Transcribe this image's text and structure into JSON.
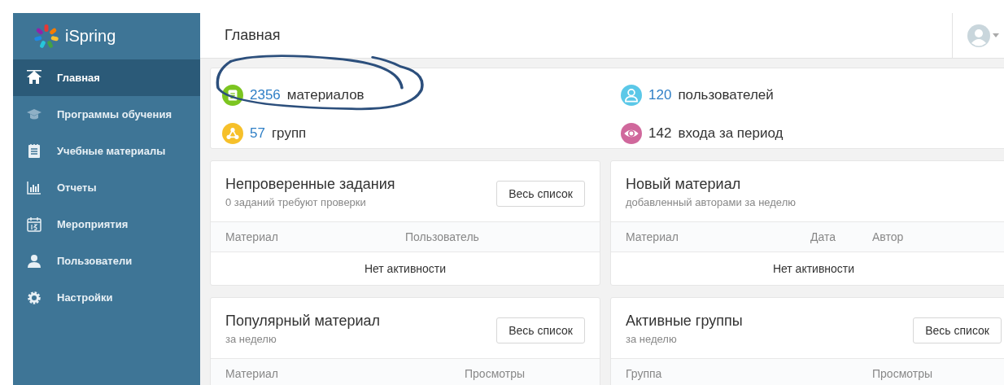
{
  "sidebar": {
    "logo": "iSpring",
    "items": [
      {
        "label": "Главная",
        "kind": "home",
        "selected": true
      },
      {
        "label": "Программы обучения",
        "kind": "cap",
        "selected": false
      },
      {
        "label": "Учебные материалы",
        "kind": "notepad",
        "selected": false
      },
      {
        "label": "Отчеты",
        "kind": "chart",
        "selected": false
      },
      {
        "label": "Мероприятия",
        "kind": "calendar",
        "selected": false
      },
      {
        "label": "Пользователи",
        "kind": "user",
        "selected": false
      },
      {
        "label": "Настройки",
        "kind": "gear",
        "selected": false
      }
    ]
  },
  "header": {
    "title": "Главная"
  },
  "stats": [
    {
      "kind": "document",
      "color": "#7cc520",
      "number": "2356",
      "label": "материалов",
      "linked": true
    },
    {
      "kind": "user",
      "color": "#5bc8e8",
      "number": "120",
      "label": "пользователей",
      "linked": true
    },
    {
      "kind": "network",
      "color": "#f6c02a",
      "number": "57",
      "label": "групп",
      "linked": true
    },
    {
      "kind": "eye",
      "color": "#d0689c",
      "number": "142",
      "label": "входа за период",
      "linked": false
    }
  ],
  "cards": [
    {
      "title": "Непроверенные задания",
      "subtitle": "0 заданий требуют проверки",
      "button": "Весь список",
      "columns": [
        "Материал",
        "Пользователь"
      ],
      "empty": "Нет активности"
    },
    {
      "title": "Новый материал",
      "subtitle": "добавленный авторами за неделю",
      "columns": [
        "Материал",
        "Дата",
        "Автор"
      ],
      "empty": "Нет активности"
    },
    {
      "title": "Популярный материал",
      "subtitle": "за неделю",
      "button": "Весь список",
      "columns": [
        "Материал",
        "Просмотры"
      ]
    },
    {
      "title": "Активные группы",
      "subtitle": "за неделю",
      "button": "Весь список",
      "columns": [
        "Группа",
        "Просмотры"
      ]
    }
  ]
}
